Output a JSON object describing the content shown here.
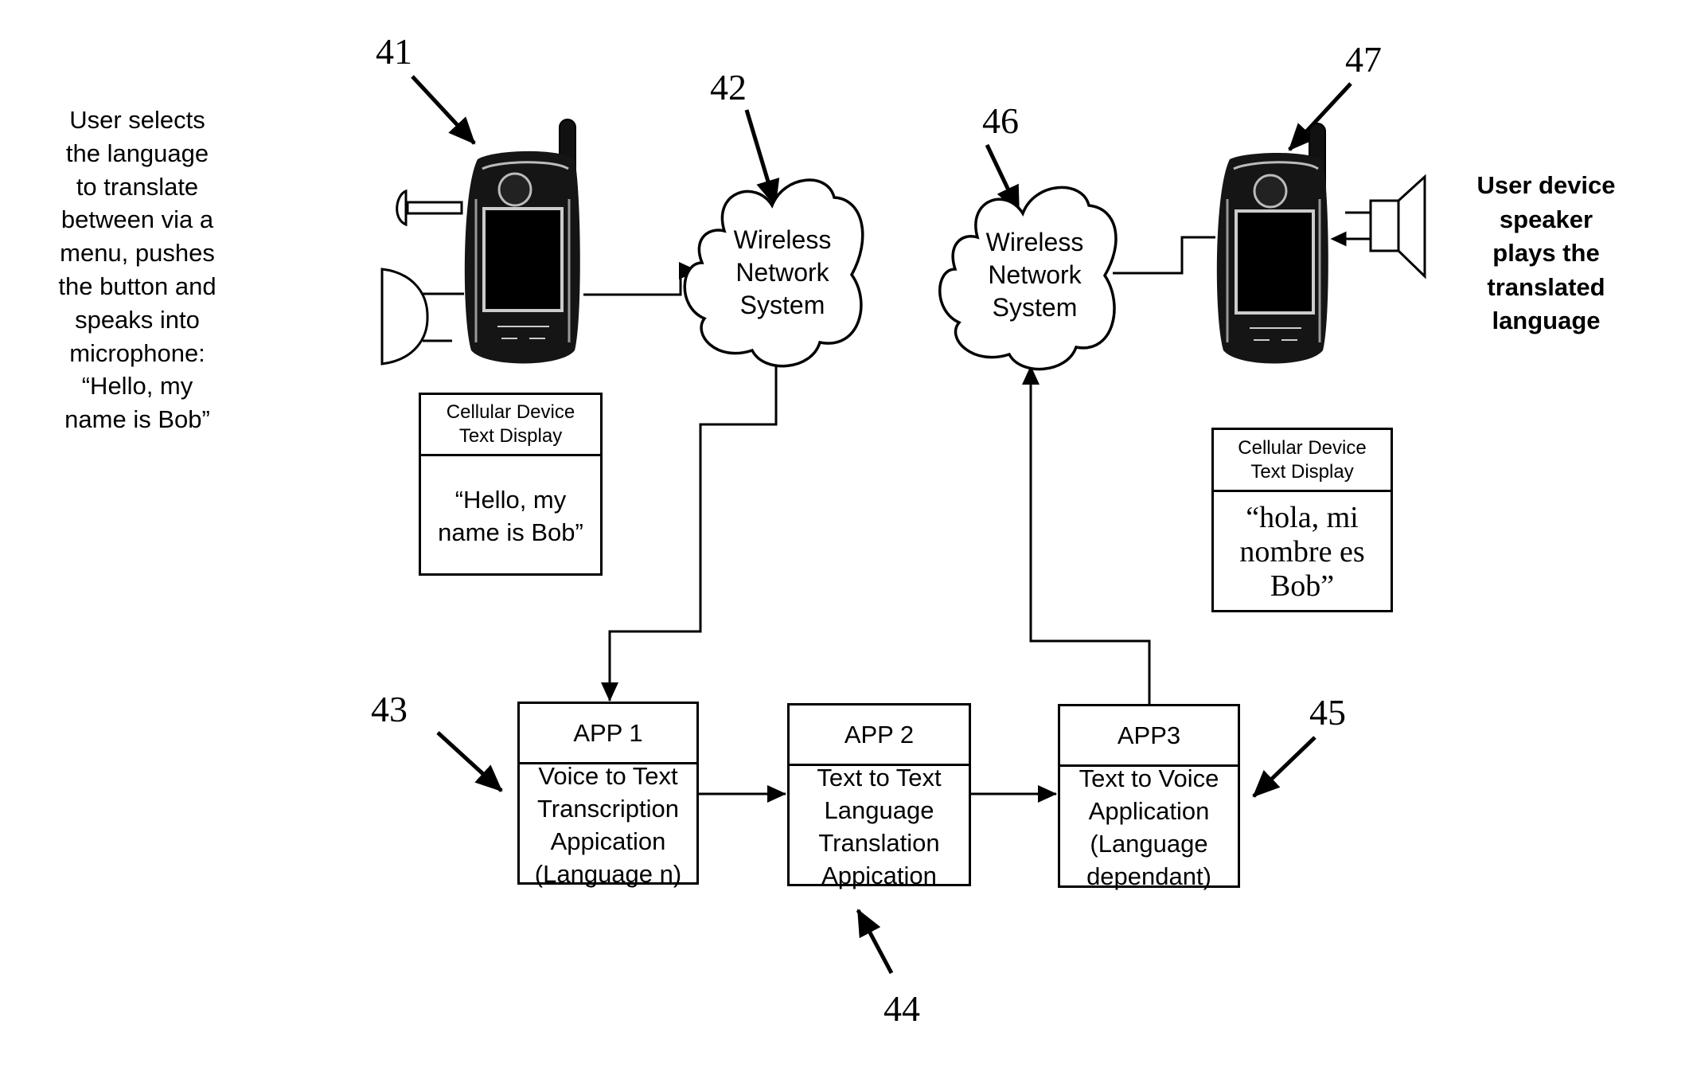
{
  "diagram": {
    "reference_numerals": {
      "phone_sender": "41",
      "network_sender": "42",
      "app1": "43",
      "app2": "44",
      "app3": "45",
      "network_receiver": "46",
      "phone_receiver": "47"
    },
    "left_note": {
      "lines": [
        "User selects",
        "the language",
        "to translate",
        "between via a",
        "menu, pushes",
        "the button and",
        "speaks into",
        "microphone:",
        "“Hello, my",
        "name is Bob”"
      ]
    },
    "right_note": {
      "lines": [
        "User device",
        "speaker",
        "plays the",
        "translated",
        "language"
      ]
    },
    "clouds": [
      {
        "lines": [
          "Wireless",
          "Network",
          "System"
        ]
      },
      {
        "lines": [
          "Wireless",
          "Network",
          "System"
        ]
      }
    ],
    "sender_display": {
      "header": [
        "Cellular Device",
        "Text Display"
      ],
      "text": [
        "“Hello, my",
        "name is Bob”"
      ]
    },
    "receiver_display": {
      "header": [
        "Cellular Device",
        "Text Display"
      ],
      "text": [
        "“hola, mi",
        "nombre es",
        "Bob”"
      ]
    },
    "apps": [
      {
        "title": "APP 1",
        "lines": [
          "Voice to Text",
          "Transcription",
          "Appication",
          "(Language n)"
        ]
      },
      {
        "title": "APP 2",
        "lines": [
          "Text to Text",
          "Language",
          "Translation",
          "Appication"
        ]
      },
      {
        "title": "APP3",
        "lines": [
          "Text to Voice",
          "Application",
          "(Language",
          "dependant)"
        ]
      }
    ],
    "icons": {
      "sender_phone": "cell-phone-icon",
      "receiver_phone": "cell-phone-icon",
      "push_button": "push-button-icon",
      "microphone": "microphone-icon",
      "speaker": "speaker-icon"
    }
  }
}
